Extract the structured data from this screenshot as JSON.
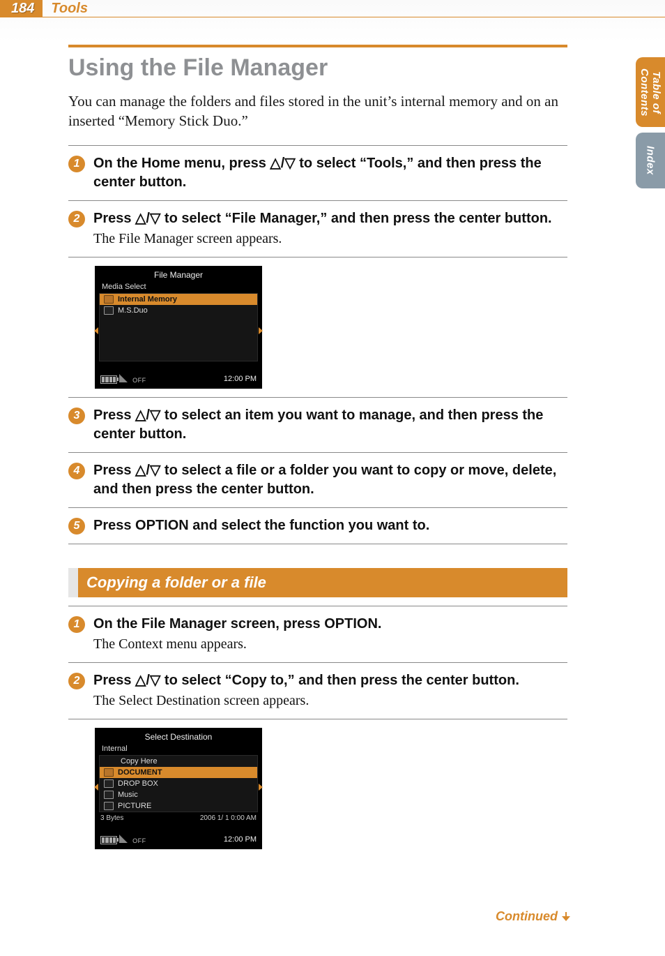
{
  "header": {
    "page_number": "184",
    "section": "Tools"
  },
  "side_tabs": {
    "toc_line1": "Table of",
    "toc_line2": "Contents",
    "index": "Index"
  },
  "title": "Using the File Manager",
  "intro": "You can manage the folders and files stored in the unit’s internal memory and on an inserted “Memory Stick Duo.”",
  "steps_a": [
    {
      "num": "1",
      "bold": "On the Home menu, press △/▽ to select “Tools,” and then press the center button."
    },
    {
      "num": "2",
      "bold": "Press △/▽ to select “File Manager,” and then press the center button.",
      "plain": "The File Manager screen appears."
    }
  ],
  "screenshot1": {
    "title": "File Manager",
    "subtitle": "Media Select",
    "rows": [
      {
        "label": "Internal Memory",
        "selected": true
      },
      {
        "label": "M.S.Duo",
        "selected": false
      }
    ],
    "off": "OFF",
    "clock": "12:00 PM"
  },
  "steps_b": [
    {
      "num": "3",
      "bold": "Press △/▽ to select an item you want to manage, and then press the center button."
    },
    {
      "num": "4",
      "bold": "Press △/▽ to select a file or a folder you want to copy or move, delete, and then press the center button."
    },
    {
      "num": "5",
      "bold": "Press OPTION and select the function you want to."
    }
  ],
  "subsection": "Copying a folder or a file",
  "steps_c": [
    {
      "num": "1",
      "bold": "On the File Manager screen, press OPTION.",
      "plain": "The Context menu appears."
    },
    {
      "num": "2",
      "bold": "Press △/▽ to select “Copy to,” and then press the center button.",
      "plain": "The Select Destination screen appears."
    }
  ],
  "screenshot2": {
    "title": "Select Destination",
    "subtitle": "Internal",
    "rows": [
      {
        "label": "Copy Here",
        "selected": false,
        "noicon": true
      },
      {
        "label": "DOCUMENT",
        "selected": true
      },
      {
        "label": "DROP BOX",
        "selected": false
      },
      {
        "label": "Music",
        "selected": false
      },
      {
        "label": "PICTURE",
        "selected": false
      }
    ],
    "status_left": "3 Bytes",
    "status_right": "2006  1/ 1  0:00 AM",
    "off": "OFF",
    "clock": "12:00 PM"
  },
  "continued": "Continued"
}
